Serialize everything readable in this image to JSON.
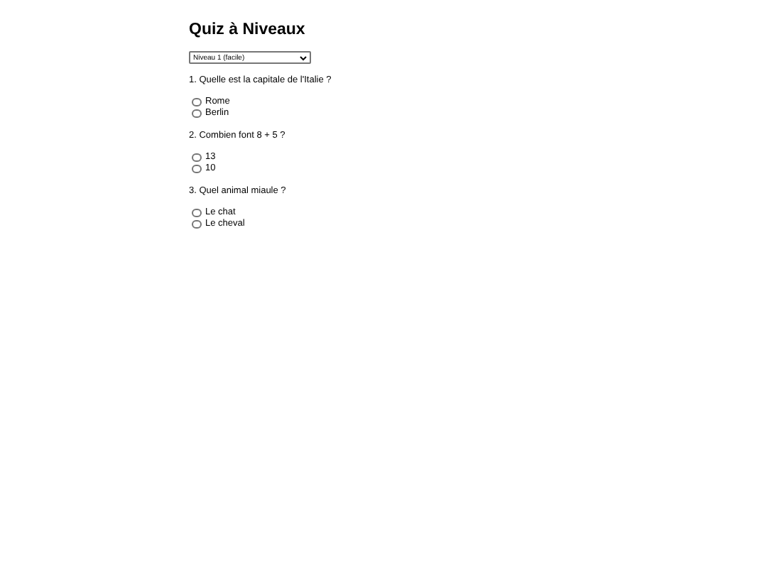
{
  "title": "Quiz à Niveaux",
  "level_select": {
    "value": "Niveau 1 (facile)"
  },
  "questions": [
    {
      "text": "1. Quelle est la capitale de l'Italie ?",
      "options": [
        {
          "label": "Rome",
          "selected": false
        },
        {
          "label": "Berlin",
          "selected": false
        }
      ]
    },
    {
      "text": "2. Combien font 8 + 5 ?",
      "options": [
        {
          "label": "13",
          "selected": false
        },
        {
          "label": "10",
          "selected": false
        }
      ]
    },
    {
      "text": "3. Quel animal miaule ?",
      "options": [
        {
          "label": "Le chat",
          "selected": false
        },
        {
          "label": "Le cheval",
          "selected": false
        }
      ]
    }
  ]
}
